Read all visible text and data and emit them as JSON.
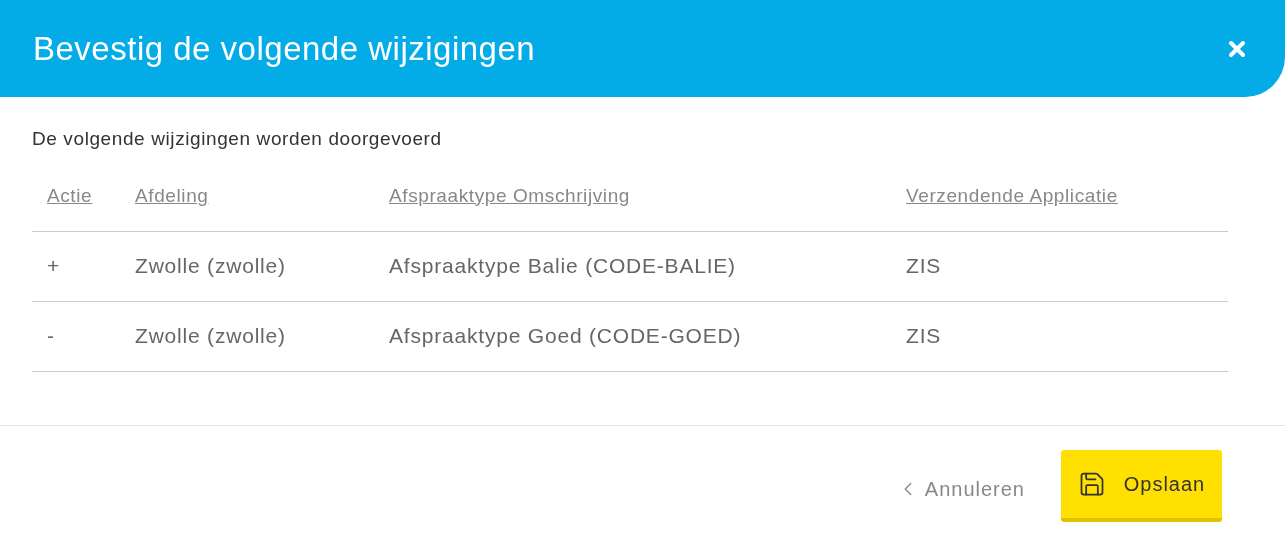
{
  "dialog": {
    "title": "Bevestig de volgende wijzigingen"
  },
  "intro": "De volgende wijzigingen worden doorgevoerd",
  "table": {
    "columns": [
      "Actie",
      "Afdeling",
      "Afspraaktype Omschrijving",
      "Verzendende Applicatie"
    ],
    "rows": [
      [
        "+",
        "Zwolle (zwolle)",
        "Afspraaktype Balie (CODE-BALIE)",
        "ZIS"
      ],
      [
        "-",
        "Zwolle (zwolle)",
        "Afspraaktype Goed (CODE-GOED)",
        "ZIS"
      ]
    ]
  },
  "footer": {
    "cancel": "Annuleren",
    "save": "Opslaan"
  }
}
